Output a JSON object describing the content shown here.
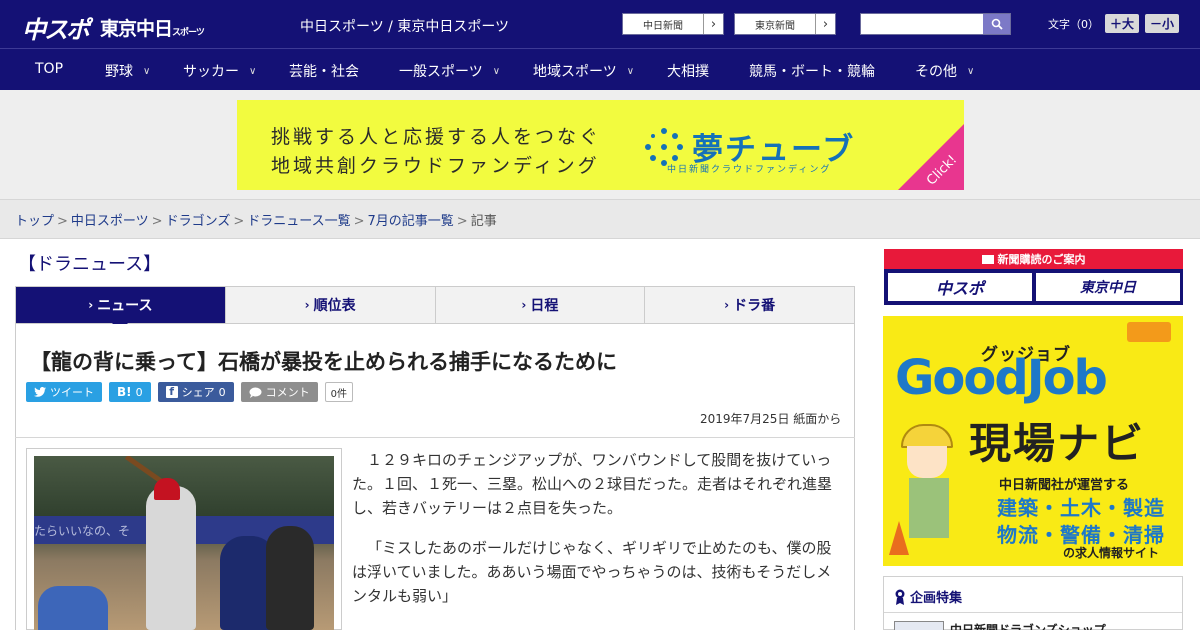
{
  "header": {
    "logo_main": "中スポ",
    "logo_tokyo": "東京中日",
    "logo_tokyo_small": "スポーツ",
    "site_title": "中日スポーツ / 東京中日スポーツ",
    "link_chunichi": "中日新聞",
    "link_tokyo": "東京新聞",
    "search_placeholder": "",
    "font_label": "文字（0）",
    "font_up": "＋大",
    "font_down": "－小"
  },
  "nav": {
    "items": [
      {
        "label": "TOP",
        "has_menu": false
      },
      {
        "label": "野球",
        "has_menu": true
      },
      {
        "label": "サッカー",
        "has_menu": true
      },
      {
        "label": "芸能・社会",
        "has_menu": false
      },
      {
        "label": "一般スポーツ",
        "has_menu": true
      },
      {
        "label": "地域スポーツ",
        "has_menu": true
      },
      {
        "label": "大相撲",
        "has_menu": false
      },
      {
        "label": "競馬・ボート・競輪",
        "has_menu": false
      },
      {
        "label": "その他",
        "has_menu": true
      }
    ]
  },
  "ad": {
    "line1": "挑戦する人と応援する人をつなぐ",
    "line2": "地域共創クラウドファンディング",
    "brand": "夢チューブ",
    "brand_sub": "中日新聞クラウドファンディング",
    "click": "Click!"
  },
  "breadcrumb": {
    "items": [
      "トップ",
      "中日スポーツ",
      "ドラゴンズ",
      "ドラニュース一覧",
      "7月の記事一覧"
    ],
    "current": "記事",
    "sep": ">"
  },
  "section": {
    "title": "【ドラニュース】"
  },
  "tabs": [
    {
      "label": "ニュース",
      "active": true
    },
    {
      "label": "順位表",
      "active": false
    },
    {
      "label": "日程",
      "active": false
    },
    {
      "label": "ドラ番",
      "active": false
    }
  ],
  "article": {
    "headline": "【龍の背に乗って】石橋が暴投を止められる捕手になるために",
    "social": {
      "tweet": "ツイート",
      "hatena_count": "0",
      "share": "シェア",
      "share_count": "0",
      "comment": "コメント",
      "comment_count": "0件"
    },
    "dateline": "2019年7月25日 紙面から",
    "photo_wall_text": "たらいいなの、そ",
    "paragraphs": [
      "１２９キロのチェンジアップが、ワンバウンドして股間を抜けていった。１回、１死一、三塁。松山への２球目だった。走者はそれぞれ進塁し、若きバッテリーは２点目を失った。",
      "「ミスしたあのボールだけじゃなく、ギリギリで止めたのも、僕の股は浮いていました。ああいう場面でやっちゃうのは、技術もそうだしメンタルも弱い」"
    ]
  },
  "sidebar": {
    "subscribe_head": "新聞購読のご案内",
    "subscribe_chuspo": "中スポ",
    "subscribe_tokyo": "東京中日",
    "job_top": "グッジョブ",
    "job_brand": "GoodJob",
    "job_navi": "現場ナビ",
    "job_sub": "中日新聞社が運営する",
    "job_line2": "建築・土木・製造",
    "job_line3": "物流・警備・清掃",
    "job_line4": "の求人情報サイト",
    "plan_title": "企画特集",
    "plan_item": "中日新聞ドラゴンズショップ"
  },
  "colors": {
    "brand_navy": "#141175",
    "ad_yellow": "#f2fb3f",
    "accent_pink": "#e8368f",
    "job_yellow": "#f9ea15",
    "job_blue": "#1e78c8"
  }
}
